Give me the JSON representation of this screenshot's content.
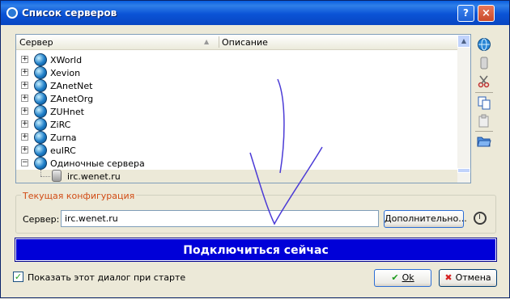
{
  "window": {
    "title": "Список серверов",
    "help": "?",
    "close": "×"
  },
  "tree": {
    "columns": [
      "Сервер",
      "Описание"
    ],
    "rows": [
      {
        "label": "XWorld",
        "type": "network"
      },
      {
        "label": "Xevion",
        "type": "network"
      },
      {
        "label": "ZAnetNet",
        "type": "network"
      },
      {
        "label": "ZAnetOrg",
        "type": "network"
      },
      {
        "label": "ZUHnet",
        "type": "network"
      },
      {
        "label": "ZiRC",
        "type": "network"
      },
      {
        "label": "Zurna",
        "type": "network"
      },
      {
        "label": "euIRC",
        "type": "network"
      },
      {
        "label": "Одиночные сервера",
        "type": "network-expanded"
      },
      {
        "label": "irc.wenet.ru",
        "type": "server-selected"
      }
    ]
  },
  "config": {
    "legend": "Текущая конфигурация",
    "server_label": "Сервер:",
    "server_value": "irc.wenet.ru",
    "more_button": "Дополнительно..."
  },
  "connect_button": "Подключиться сейчас",
  "footer": {
    "checkbox_label": "Показать этот диалог при старте",
    "checkbox_checked": true,
    "ok": "Ok",
    "cancel": "Отмена"
  },
  "colors": {
    "connect_bg": "#0000d8",
    "legend_text": "#d14b14",
    "annotation_stroke": "#4b3bd6"
  },
  "icons": [
    "globe-icon",
    "server-icon",
    "scissors-icon",
    "copy-icon",
    "paste-icon",
    "folder-open-icon",
    "timer-icon",
    "check-icon",
    "cancel-x-icon"
  ]
}
